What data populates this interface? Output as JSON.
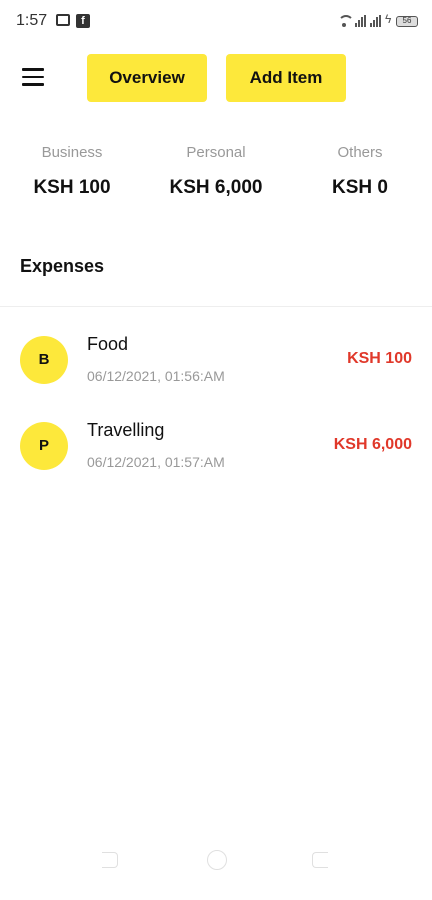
{
  "status_bar": {
    "time": "1:57",
    "battery": "56"
  },
  "header": {
    "overview_label": "Overview",
    "add_item_label": "Add Item",
    "menu_icon": "hamburger-menu-icon"
  },
  "summary": [
    {
      "label": "Business",
      "value": "KSH 100"
    },
    {
      "label": "Personal",
      "value": "KSH 6,000"
    },
    {
      "label": "Others",
      "value": "KSH 0"
    }
  ],
  "section_title": "Expenses",
  "expenses": [
    {
      "initial": "B",
      "name": "Food",
      "date": "06/12/2021, 01:56:AM",
      "amount": "KSH 100"
    },
    {
      "initial": "P",
      "name": "Travelling",
      "date": "06/12/2021, 01:57:AM",
      "amount": "KSH 6,000"
    }
  ],
  "colors": {
    "accent": "#fde83b",
    "amount": "#e0382a",
    "muted": "#999999"
  }
}
